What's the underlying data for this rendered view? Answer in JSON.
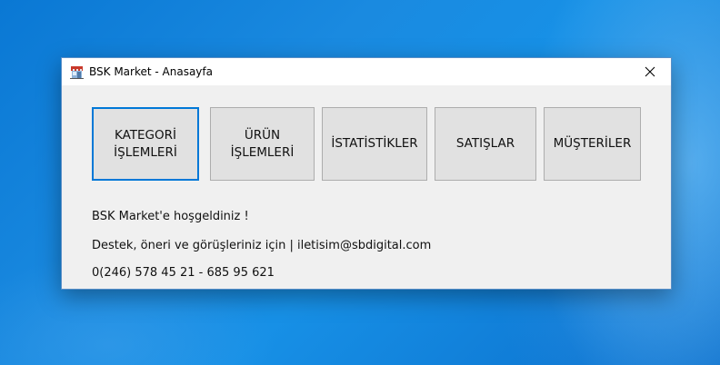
{
  "window": {
    "title": "BSK Market - Anasayfa",
    "icon": "storefront-icon",
    "close_icon": "close-icon"
  },
  "buttons": [
    {
      "label": "KATEGORİ\nİŞLEMLERİ",
      "focused": true
    },
    {
      "label": "ÜRÜN\nİŞLEMLERİ",
      "focused": false
    },
    {
      "label": "İSTATİSTİKLER",
      "focused": false
    },
    {
      "label": "SATIŞLAR",
      "focused": false
    },
    {
      "label": "MÜŞTERİLER",
      "focused": false
    }
  ],
  "info": {
    "welcome": "BSK Market'e hoşgeldiniz !",
    "support": "Destek, öneri ve görüşleriniz için | iletisim@sbdigital.com",
    "phone": "0(246) 578 45 21 - 685 95 621"
  },
  "colors": {
    "focus_border": "#0078d7",
    "button_bg": "#e1e1e1",
    "window_bg": "#f0f0f0",
    "desktop": "#0a78d4"
  }
}
